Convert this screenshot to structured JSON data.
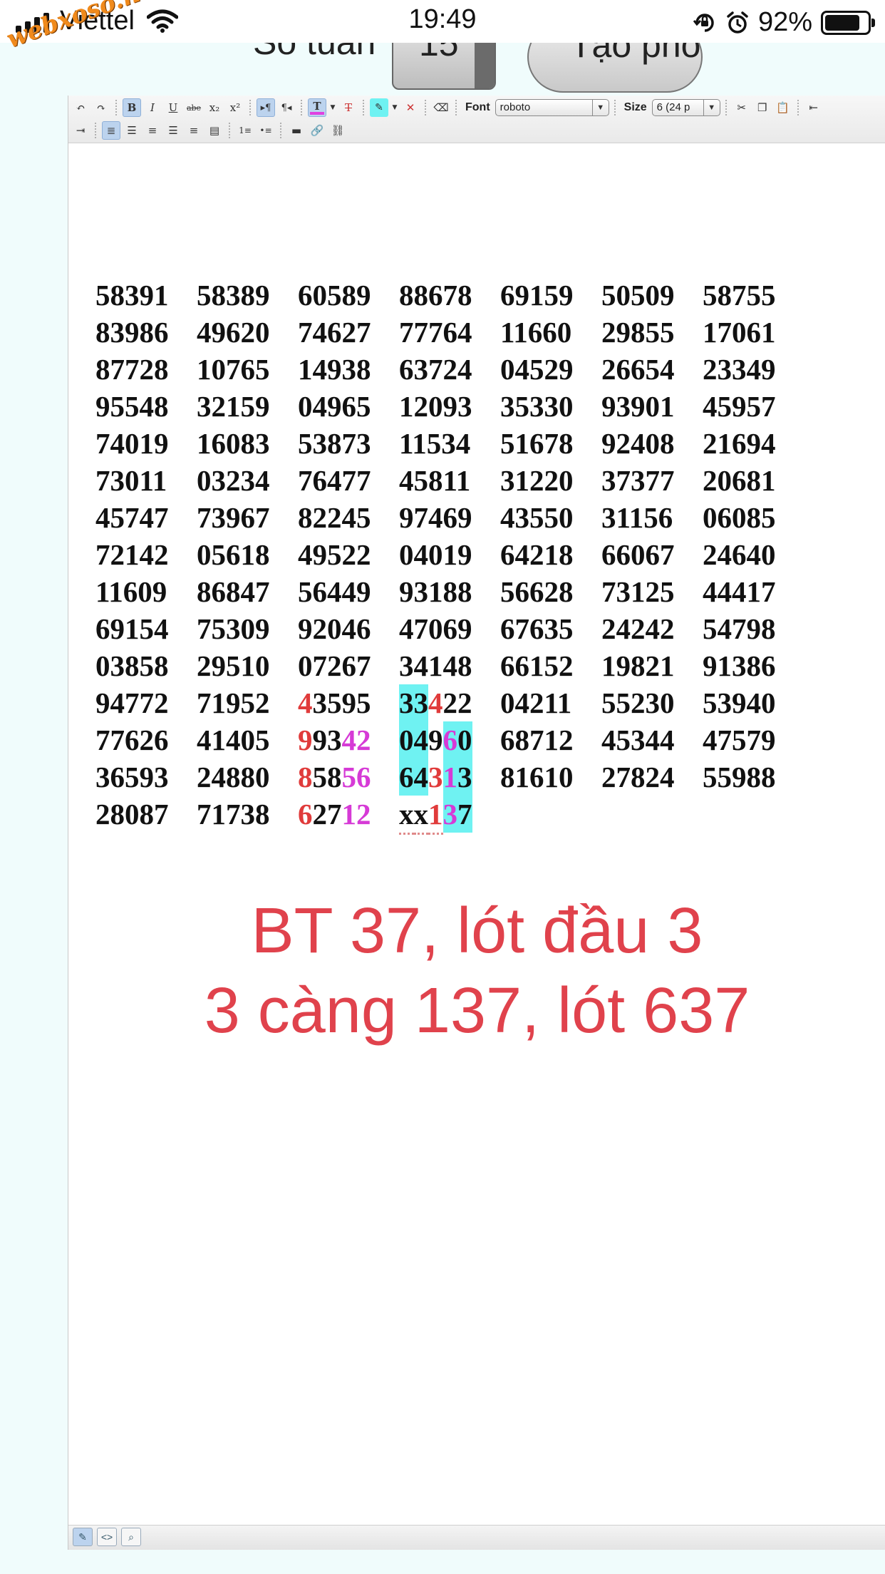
{
  "status_bar": {
    "carrier": "Viettel",
    "time": "19:49",
    "battery_percent": "92%",
    "battery_level": 0.92,
    "icons": [
      "signal-icon",
      "wifi-icon",
      "rotation-lock-icon",
      "alarm-icon",
      "battery-icon"
    ]
  },
  "watermark": "webxoso.net",
  "header": {
    "weeks_label": "Số tuần",
    "weeks_value": "15",
    "create_button_label": "Tạo phô"
  },
  "toolbar": {
    "font_label": "Font",
    "font_value": "roboto",
    "size_label": "Size",
    "size_value": "6 (24 p",
    "text_color_accent": "#e040e0",
    "highlight_accent": "#6ff2f2"
  },
  "grid": {
    "rows": [
      [
        "58391",
        "58389",
        "60589",
        "88678",
        "69159",
        "50509",
        "58755"
      ],
      [
        "83986",
        "49620",
        "74627",
        "77764",
        "11660",
        "29855",
        "17061"
      ],
      [
        "87728",
        "10765",
        "14938",
        "63724",
        "04529",
        "26654",
        "23349"
      ],
      [
        "95548",
        "32159",
        "04965",
        "12093",
        "35330",
        "93901",
        "45957"
      ],
      [
        "74019",
        "16083",
        "53873",
        "11534",
        "51678",
        "92408",
        "21694"
      ],
      [
        "73011",
        "03234",
        "76477",
        "45811",
        "31220",
        "37377",
        "20681"
      ],
      [
        "45747",
        "73967",
        "82245",
        "97469",
        "43550",
        "31156",
        "06085"
      ],
      [
        "72142",
        "05618",
        "49522",
        "04019",
        "64218",
        "66067",
        "24640"
      ],
      [
        "11609",
        "86847",
        "56449",
        "93188",
        "56628",
        "73125",
        "44417"
      ],
      [
        "69154",
        "75309",
        "92046",
        "47069",
        "67635",
        "24242",
        "54798"
      ],
      [
        "03858",
        "29510",
        "07267",
        "34148",
        "66152",
        "19821",
        "91386"
      ],
      [
        "94772",
        "71952",
        "43595",
        "33422",
        "04211",
        "55230",
        "53940"
      ],
      [
        "77626",
        "41405",
        "99342",
        "04960",
        "68712",
        "45344",
        "47579"
      ],
      [
        "36593",
        "24880",
        "85856",
        "64313",
        "81610",
        "27824",
        "55988"
      ],
      [
        "28087",
        "71738",
        "62712",
        "xx137"
      ]
    ],
    "highlight_colors": {
      "red": "#e03b3b",
      "magenta": "#d63ad6",
      "cyan": "#6ff2f2"
    }
  },
  "message": {
    "line1": "BT 37, lót đầu 3",
    "line2": "3 càng 137, lót 637",
    "color": "#e0424c"
  },
  "footer_modes": [
    "design-mode-icon",
    "html-mode-icon",
    "preview-mode-icon"
  ]
}
